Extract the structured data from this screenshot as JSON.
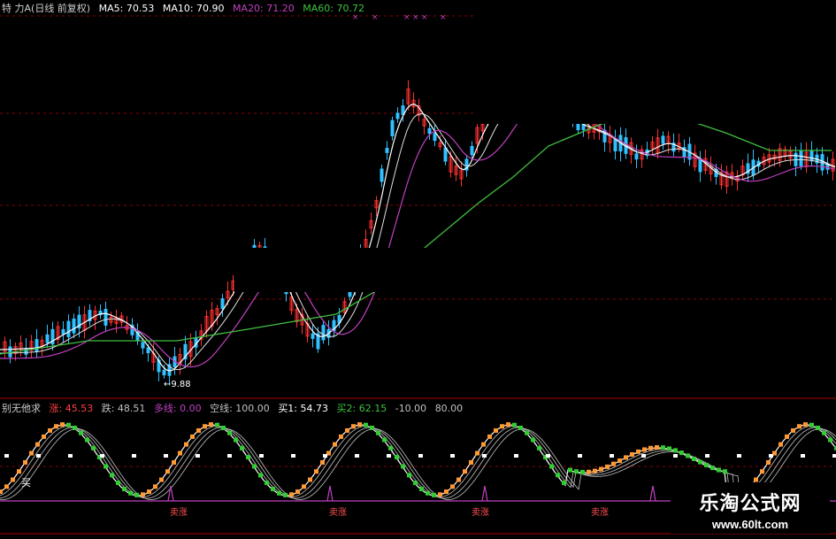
{
  "main_header": {
    "title": "特 力A(日线 前复权)",
    "ma": [
      {
        "label": "MA5: 70.53",
        "color": "#ffffff"
      },
      {
        "label": "MA10: 70.90",
        "color": "#ffffff"
      },
      {
        "label": "MA20: 71.20",
        "color": "#c040c0"
      },
      {
        "label": "MA60: 70.72",
        "color": "#40c040"
      }
    ]
  },
  "low_annotation": "←9.88",
  "indicator_header": {
    "name": "别无他求",
    "items": [
      {
        "label": "涨: 45.53",
        "color": "#ff4040"
      },
      {
        "label": "跌: 48.51",
        "color": "#c0c0c0"
      },
      {
        "label": "多线: 0.00",
        "color": "#c040c0"
      },
      {
        "label": "空线: 100.00",
        "color": "#c0c0c0"
      },
      {
        "label": "买1: 54.73",
        "color": "#ffffff"
      },
      {
        "label": "买2: 62.15",
        "color": "#40c040"
      },
      {
        "label": "-10.00",
        "color": "#c0c0c0"
      },
      {
        "label": "80.00",
        "color": "#c0c0c0"
      }
    ]
  },
  "buy_label": "买",
  "sell_label": "卖涨",
  "watermark": {
    "title": "乐淘公式网",
    "url": "www.60lt.com"
  },
  "colors": {
    "up": "#ff3030",
    "down": "#30c0ff",
    "ma5": "#ffffff",
    "ma20": "#c040c0",
    "ma60": "#40c040",
    "grid": "#8b0000",
    "osc_up": "#ff9933",
    "osc_down": "#33cc33"
  }
}
